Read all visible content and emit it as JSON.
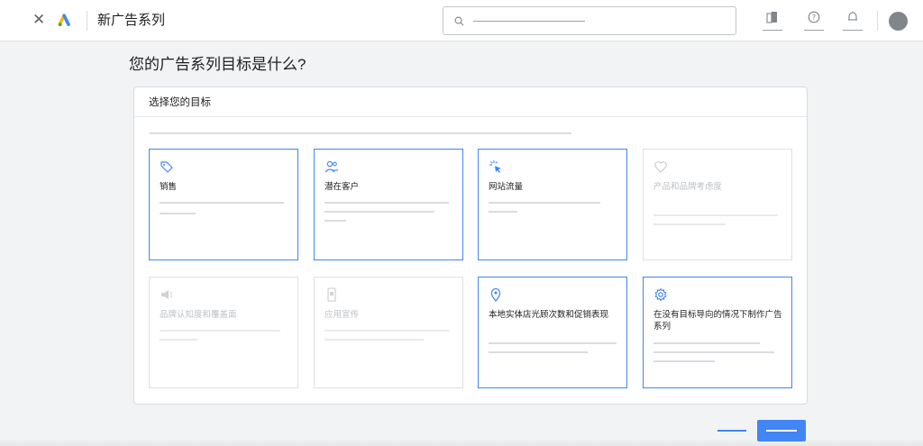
{
  "header": {
    "title": "新广告系列",
    "close_icon": "close-icon",
    "logo": "google-ads-logo",
    "search_icon": "search-icon",
    "tools": [
      "reports-icon",
      "help-icon",
      "notifications-icon"
    ]
  },
  "page": {
    "heading": "您的广告系列目标是什么?"
  },
  "panel": {
    "title": "选择您的目标",
    "goals": [
      {
        "label": "销售",
        "icon": "tag-icon",
        "enabled": true
      },
      {
        "label": "潜在客户",
        "icon": "people-icon",
        "enabled": true
      },
      {
        "label": "网站流量",
        "icon": "click-cursor-icon",
        "enabled": true
      },
      {
        "label": "产品和品牌考虑度",
        "icon": "heart-icon",
        "enabled": false
      },
      {
        "label": "品牌认知度和覆盖面",
        "icon": "megaphone-icon",
        "enabled": false
      },
      {
        "label": "应用宣传",
        "icon": "phone-icon",
        "enabled": false
      },
      {
        "label": "本地实体店光顾次数和促销表现",
        "icon": "location-pin-icon",
        "enabled": true
      },
      {
        "label": "在没有目标导向的情况下制作广告系列",
        "icon": "gear-icon",
        "enabled": true
      }
    ]
  },
  "colors": {
    "accent": "#4285f4",
    "card_disabled_border": "#e0e0e0",
    "disabled_text": "#bdc1c6",
    "background": "#f1f3f4"
  }
}
